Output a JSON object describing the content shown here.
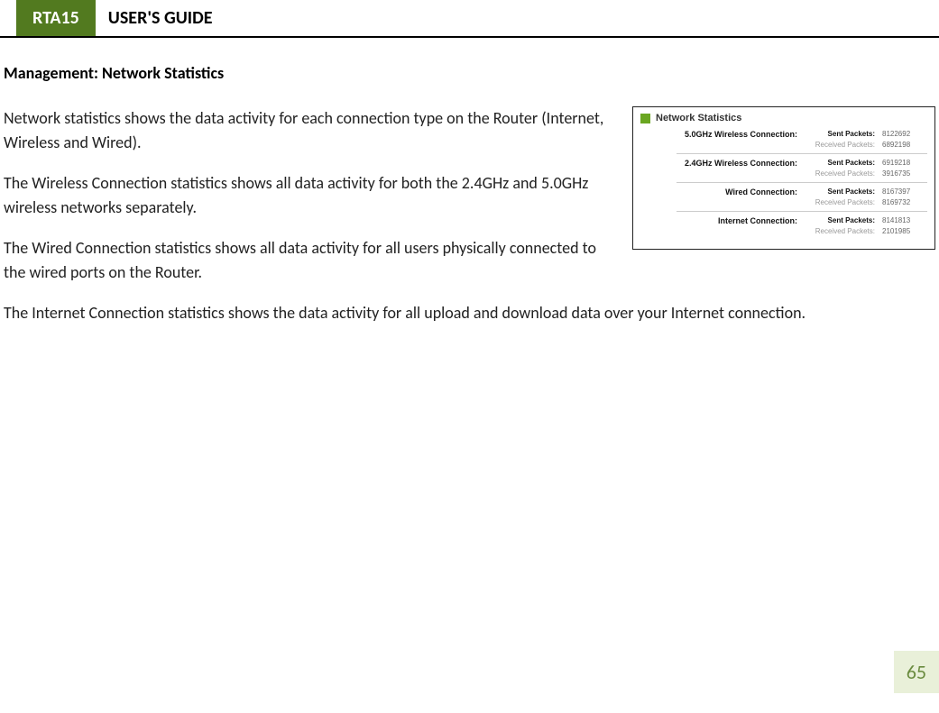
{
  "header": {
    "badge": "RTA15",
    "title": "USER'S GUIDE"
  },
  "section_title": "Management: Network Statistics",
  "paragraphs": {
    "p1": "Network statistics shows the data activity for each connection type on the Router (Internet, Wireless and Wired).",
    "p2": "The Wireless Connection statistics shows all data activity for both the 2.4GHz and 5.0GHz wireless networks separately.",
    "p3": "The Wired Connection statistics shows all data activity for all users physically connected to the wired ports on the Router.",
    "p4": "The Internet Connection statistics shows the data activity for all upload and download data over your Internet connection."
  },
  "screenshot": {
    "title": "Network Statistics",
    "labels": {
      "sent": "Sent Packets:",
      "received": "Received Packets:"
    },
    "blocks": [
      {
        "conn": "5.0GHz Wireless Connection:",
        "sent": "8122692",
        "recv": "6892198"
      },
      {
        "conn": "2.4GHz Wireless Connection:",
        "sent": "6919218",
        "recv": "3916735"
      },
      {
        "conn": "Wired Connection:",
        "sent": "8167397",
        "recv": "8169732"
      },
      {
        "conn": "Internet Connection:",
        "sent": "8141813",
        "recv": "2101985"
      }
    ]
  },
  "page_number": "65"
}
